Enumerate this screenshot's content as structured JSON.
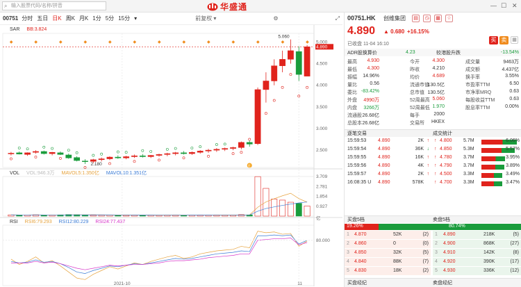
{
  "topbar": {
    "search_placeholder": "输入股票代码/名称/拼音",
    "brand_name": "华盛通"
  },
  "toolbar": {
    "code": "00751",
    "tabs": [
      "分时",
      "五日",
      "日K",
      "周K",
      "月K",
      "1分",
      "5分",
      "15分"
    ],
    "active_tab": 2,
    "restore": "前复权"
  },
  "sar": {
    "name": "SAR",
    "bb": "BB:3.824",
    "peak_label": "5.060",
    "low_label": "2.180",
    "badge": "E",
    "scale": [
      "5.000",
      "4.890",
      "4.500",
      "4.000",
      "3.500",
      "3.000",
      "2.500"
    ]
  },
  "vol": {
    "name": "VOL",
    "vol": "VOL:946.3万",
    "ma5": "MAVOL5:1.350亿",
    "ma10": "MAVOL10:1.351亿",
    "scale": [
      "3.709",
      "2.781",
      "1.854",
      "0.927"
    ],
    "unit": "亿"
  },
  "rsi": {
    "name": "RSI",
    "r6": "RSI6:79.293",
    "r12": "RSI12:80.229",
    "r24": "RSI24:77.437",
    "scale": "80.000"
  },
  "xaxis": {
    "month1": "2021-10",
    "month2": "11"
  },
  "quote": {
    "code": "00751.HK",
    "name": "创维集团",
    "price": "4.890",
    "change": "0.680",
    "pct": "+16.15%",
    "time": "已收盘 11-04 16:10",
    "buy": "买",
    "sell": "卖"
  },
  "adr": {
    "label": "ADR股换算价",
    "value": "4.23",
    "label2": "较港股升跌",
    "value2": "-13.54%"
  },
  "stats": [
    [
      "最高",
      "4.930",
      "今开",
      "4.300",
      "成交量",
      "9463万"
    ],
    [
      "最低",
      "4.300",
      "昨收",
      "4.210",
      "成交额",
      "4.437亿"
    ],
    [
      "振幅",
      "14.96%",
      "均价",
      "4.689",
      "换手率",
      "3.55%"
    ],
    [
      "量比",
      "0.56",
      "流通市值",
      "130.5亿",
      "市盈率TTM",
      "6.50"
    ],
    [
      "委比",
      "-83.42%",
      "总市值",
      "130.5亿",
      "市净率MRQ",
      "0.63"
    ],
    [
      "外盘",
      "4990万",
      "52周最高",
      "5.060",
      "每股收益TTM",
      "0.63"
    ],
    [
      "内盘",
      "3266万",
      "52周最低",
      "1.970",
      "股息率TTM",
      "0.00%"
    ],
    [
      "流通股",
      "26.68亿",
      "每手",
      "2000",
      "",
      ""
    ],
    [
      "总股本",
      "26.68亿",
      "交易所",
      "HKEX",
      "",
      ""
    ]
  ],
  "trades_title": "逐笔交易",
  "trades": [
    {
      "t": "15:59:53",
      "p": "4.890",
      "v": "2K",
      "d": "up"
    },
    {
      "t": "15:59:54",
      "p": "4.890",
      "v": "36K",
      "d": "dn"
    },
    {
      "t": "15:59:55",
      "p": "4.890",
      "v": "16K",
      "d": "up"
    },
    {
      "t": "15:59:56",
      "p": "4.890",
      "v": "4K",
      "d": "up"
    },
    {
      "t": "15:59:57",
      "p": "4.890",
      "v": "2K",
      "d": "up"
    },
    {
      "t": "16:08:35 U",
      "p": "4.890",
      "v": "578K",
      "d": ""
    }
  ],
  "flow_title": "成交统计",
  "flow": [
    {
      "p": "4.800",
      "v": "5.7M",
      "pct": "6.06%",
      "f": 0.98
    },
    {
      "p": "4.850",
      "v": "5.3M",
      "pct": "5.57%",
      "f": 0.92
    },
    {
      "p": "4.780",
      "v": "3.7M",
      "pct": "3.95%",
      "f": 0.65
    },
    {
      "p": "4.790",
      "v": "3.7M",
      "pct": "3.89%",
      "f": 0.64
    },
    {
      "p": "4.500",
      "v": "3.3M",
      "pct": "3.49%",
      "f": 0.58
    },
    {
      "p": "4.700",
      "v": "3.3M",
      "pct": "3.47%",
      "f": 0.57
    }
  ],
  "book": {
    "bid_title": "买盘5档",
    "ask_title": "卖盘5档",
    "bid_pct": "19.26%",
    "ask_pct": "80.74%",
    "bid_frac": 0.1926,
    "bids": [
      {
        "l": "1",
        "p": "4.870",
        "v": "52K",
        "n": "(2)"
      },
      {
        "l": "2",
        "p": "4.860",
        "v": "0",
        "n": "(0)"
      },
      {
        "l": "3",
        "p": "4.850",
        "v": "32K",
        "n": "(5)"
      },
      {
        "l": "4",
        "p": "4.840",
        "v": "88K",
        "n": "(7)"
      },
      {
        "l": "5",
        "p": "4.830",
        "v": "18K",
        "n": "(2)"
      }
    ],
    "asks": [
      {
        "l": "1",
        "p": "4.890",
        "v": "218K",
        "n": "(5)"
      },
      {
        "l": "2",
        "p": "4.900",
        "v": "868K",
        "n": "(27)"
      },
      {
        "l": "3",
        "p": "4.910",
        "v": "142K",
        "n": "(8)"
      },
      {
        "l": "4",
        "p": "4.920",
        "v": "390K",
        "n": "(17)"
      },
      {
        "l": "5",
        "p": "4.930",
        "v": "336K",
        "n": "(12)"
      }
    ]
  },
  "footer": {
    "bid_broker": "买盘经纪",
    "ask_broker": "卖盘经纪"
  },
  "colors": {
    "up": "#e0231c",
    "down": "#1a9c3c",
    "accent": "#3a7bd5"
  },
  "chart_data": {
    "type": "candlestick",
    "candles": [
      [
        2.42,
        2.46,
        2.38,
        2.43
      ],
      [
        2.44,
        2.47,
        2.4,
        2.41
      ],
      [
        2.4,
        2.45,
        2.37,
        2.44
      ],
      [
        2.45,
        2.5,
        2.42,
        2.47
      ],
      [
        2.47,
        2.49,
        2.4,
        2.42
      ],
      [
        2.42,
        2.46,
        2.38,
        2.45
      ],
      [
        2.44,
        2.47,
        2.39,
        2.4
      ],
      [
        2.39,
        2.42,
        2.3,
        2.32
      ],
      [
        2.33,
        2.36,
        2.24,
        2.26
      ],
      [
        2.25,
        2.29,
        2.18,
        2.24
      ],
      [
        2.24,
        2.3,
        2.2,
        2.28
      ],
      [
        2.28,
        2.33,
        2.24,
        2.3
      ],
      [
        2.3,
        2.36,
        2.27,
        2.34
      ],
      [
        2.34,
        2.38,
        2.3,
        2.32
      ],
      [
        2.32,
        2.37,
        2.29,
        2.35
      ],
      [
        2.35,
        2.4,
        2.32,
        2.37
      ],
      [
        2.37,
        2.41,
        2.33,
        2.35
      ],
      [
        2.35,
        2.39,
        2.32,
        2.38
      ],
      [
        2.38,
        2.42,
        2.35,
        2.4
      ],
      [
        2.4,
        2.44,
        2.36,
        2.42
      ],
      [
        2.42,
        2.46,
        2.38,
        2.44
      ],
      [
        2.44,
        2.48,
        2.4,
        2.42
      ],
      [
        2.42,
        2.47,
        2.39,
        2.45
      ],
      [
        2.45,
        2.5,
        2.42,
        2.48
      ],
      [
        2.48,
        2.53,
        2.44,
        2.5
      ],
      [
        2.5,
        2.55,
        2.46,
        2.52
      ],
      [
        2.52,
        2.56,
        2.48,
        2.54
      ],
      [
        2.54,
        2.58,
        2.5,
        2.56
      ],
      [
        2.56,
        2.7,
        2.52,
        2.68
      ],
      [
        2.68,
        2.72,
        2.58,
        2.64
      ],
      [
        2.65,
        3.95,
        2.62,
        3.9
      ],
      [
        3.9,
        4.3,
        3.6,
        4.1
      ],
      [
        4.1,
        4.6,
        4.0,
        4.45
      ],
      [
        4.45,
        4.8,
        4.3,
        4.6
      ],
      [
        4.6,
        5.06,
        4.5,
        4.8
      ],
      [
        4.78,
        4.9,
        4.1,
        4.25
      ],
      [
        4.21,
        4.93,
        4.3,
        4.89
      ]
    ],
    "volume": [
      0.12,
      0.1,
      0.11,
      0.13,
      0.09,
      0.1,
      0.12,
      0.15,
      0.14,
      0.1,
      0.09,
      0.1,
      0.11,
      0.1,
      0.08,
      0.09,
      0.1,
      0.09,
      0.08,
      0.09,
      0.1,
      0.08,
      0.09,
      0.1,
      0.09,
      0.11,
      0.1,
      0.09,
      0.14,
      0.12,
      3.7,
      2.6,
      1.6,
      1.5,
      1.3,
      1.2,
      0.95
    ],
    "ylim": [
      2.1,
      5.2
    ],
    "vol_ylim": [
      0,
      3.709
    ],
    "rsi6": [
      55,
      48,
      52,
      58,
      50,
      53,
      46,
      38,
      30,
      28,
      35,
      40,
      45,
      42,
      46,
      50,
      48,
      52,
      55,
      58,
      60,
      56,
      58,
      62,
      64,
      66,
      67,
      68,
      72,
      70,
      92,
      90,
      91,
      88,
      89,
      72,
      79
    ],
    "rsi12": [
      52,
      50,
      51,
      54,
      51,
      52,
      49,
      44,
      38,
      36,
      40,
      43,
      46,
      45,
      47,
      49,
      48,
      50,
      52,
      54,
      56,
      55,
      56,
      58,
      60,
      62,
      63,
      64,
      66,
      65,
      86,
      86,
      87,
      86,
      87,
      75,
      80
    ],
    "rsi24": [
      50,
      50,
      50,
      52,
      50,
      51,
      49,
      46,
      43,
      41,
      43,
      45,
      47,
      46,
      47,
      48,
      48,
      49,
      50,
      52,
      53,
      53,
      54,
      55,
      57,
      58,
      59,
      60,
      62,
      62,
      80,
      81,
      82,
      82,
      83,
      74,
      77
    ],
    "rsi_ylim": [
      20,
      100
    ],
    "x_labels": [
      "2021-10",
      "11"
    ]
  }
}
